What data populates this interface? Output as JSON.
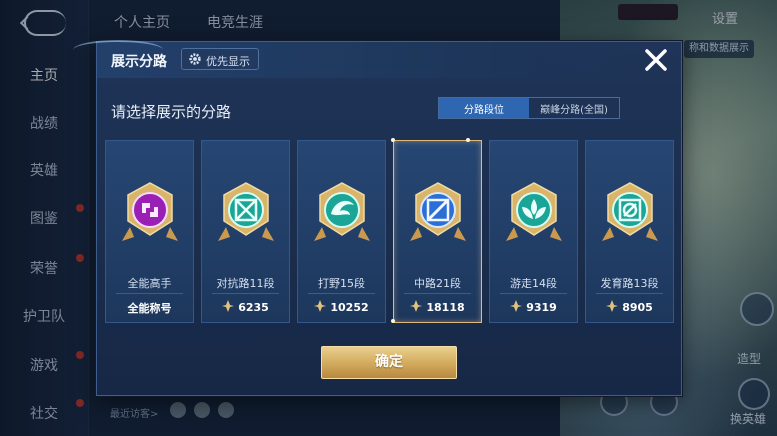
{
  "background": {
    "sidebar_items": [
      {
        "label": "主页",
        "active": true
      },
      {
        "label": "战绩",
        "active": false
      },
      {
        "label": "英雄",
        "active": false
      },
      {
        "label": "图鉴",
        "active": false,
        "badge": true
      },
      {
        "label": "荣誉",
        "active": false,
        "badge": true
      },
      {
        "label": "护卫队",
        "active": false
      },
      {
        "label": "游戏",
        "active": false,
        "badge": true
      },
      {
        "label": "社交",
        "active": false,
        "badge": true
      }
    ],
    "top_tabs": [
      "个人主页",
      "电竞生涯"
    ],
    "settings_label": "设置",
    "right_chip": "称和数据展示",
    "right_labels": [
      "造型",
      "换英雄"
    ],
    "visitors_label": "最近访客>"
  },
  "modal": {
    "title": "展示分路",
    "priority_label": "优先显示",
    "subtitle": "请选择展示的分路",
    "segments": [
      {
        "label": "分路段位",
        "active": true
      },
      {
        "label": "巅峰分路(全国)",
        "active": false
      }
    ],
    "cards": [
      {
        "name": "全能高手",
        "value": "全能称号",
        "has_icon": false,
        "emblem": "purple",
        "selected": false
      },
      {
        "name": "对抗路11段",
        "value": "6235",
        "has_icon": true,
        "emblem": "teal-x",
        "selected": false
      },
      {
        "name": "打野15段",
        "value": "10252",
        "has_icon": true,
        "emblem": "teal-dragon",
        "selected": false
      },
      {
        "name": "中路21段",
        "value": "18118",
        "has_icon": true,
        "emblem": "blue-slash",
        "selected": true
      },
      {
        "name": "游走14段",
        "value": "9319",
        "has_icon": true,
        "emblem": "teal-leaf",
        "selected": false
      },
      {
        "name": "发育路13段",
        "value": "8905",
        "has_icon": true,
        "emblem": "teal-ring",
        "selected": false
      }
    ],
    "confirm_label": "确定"
  },
  "colors": {
    "accent_gold": "#d4ac5f",
    "segment_active": "#2f66b1",
    "modal_bg": "#1f3458"
  }
}
